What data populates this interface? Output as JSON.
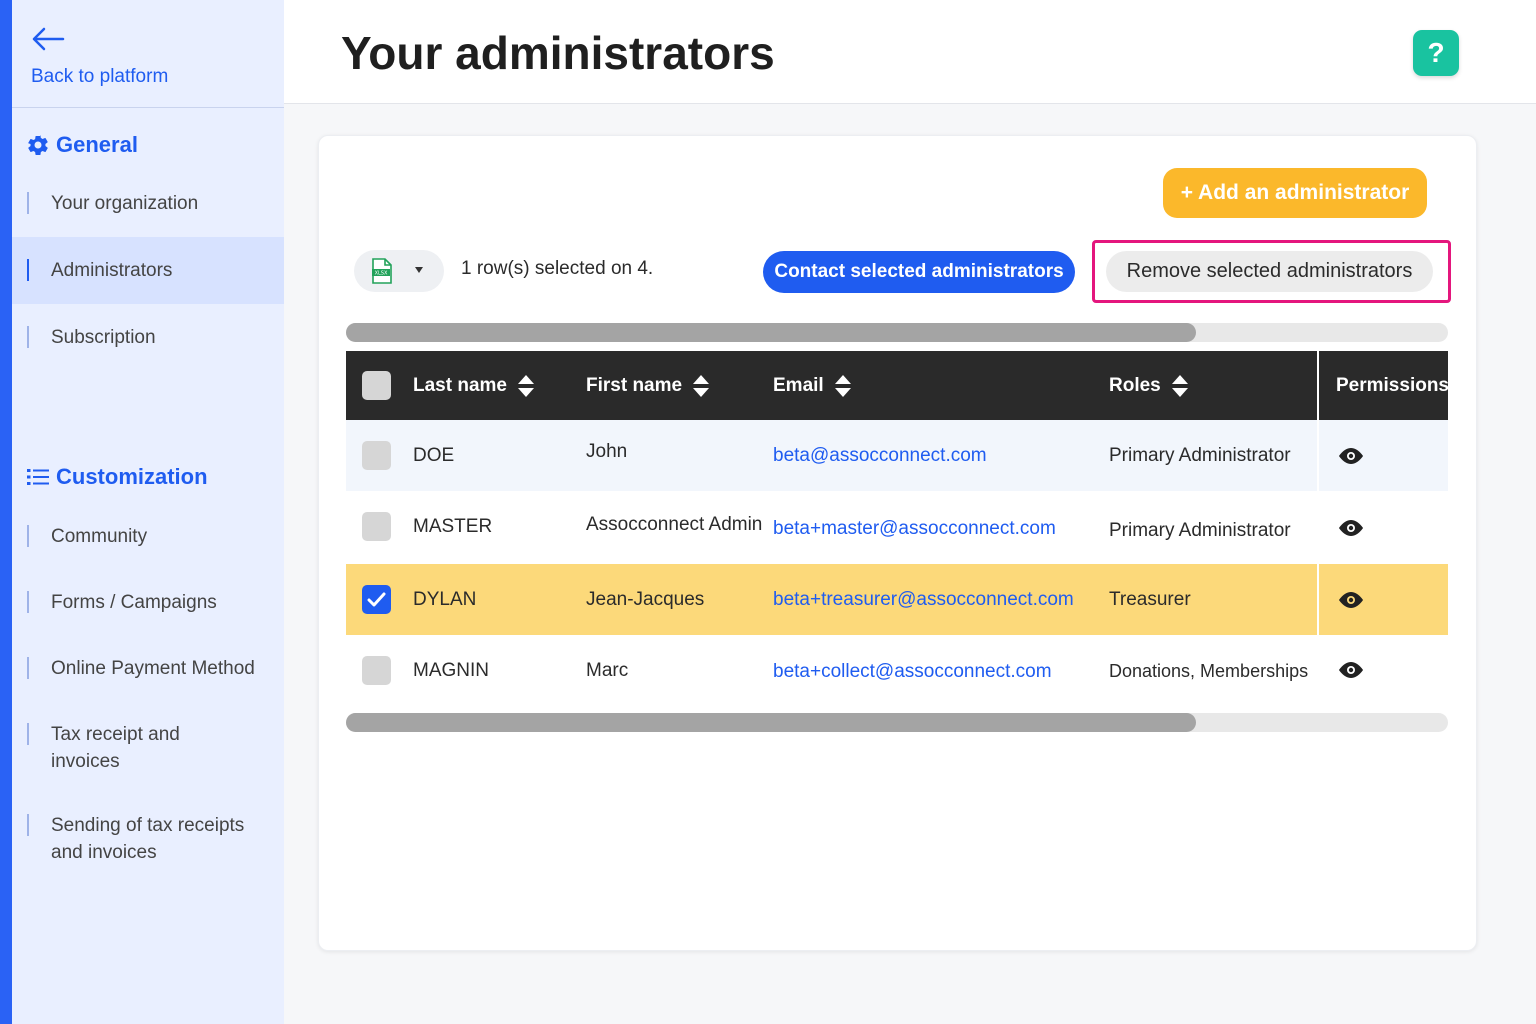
{
  "sidebar": {
    "back_label": "Back to platform",
    "sections": [
      {
        "title": "General",
        "items": [
          "Your organization",
          "Administrators",
          "Subscription"
        ]
      },
      {
        "title": "Customization",
        "items": [
          "Community",
          "Forms / Campaigns",
          "Online Payment Method",
          "Tax receipt and invoices",
          "Sending of tax receipts and invoices"
        ]
      }
    ],
    "active_item": "Administrators"
  },
  "header": {
    "title": "Your administrators",
    "help_label": "?"
  },
  "toolbar": {
    "add_label": "+ Add an administrator",
    "selection_text": "1 row(s) selected on 4.",
    "contact_label": "Contact selected administrators",
    "remove_label": "Remove selected administrators",
    "export_icon": "xlsx-file-icon",
    "export_badge": "XLSX"
  },
  "table": {
    "columns": [
      "Last name",
      "First name",
      "Email",
      "Roles",
      "Permissions"
    ],
    "rows": [
      {
        "last": "DOE",
        "first": "John",
        "email": "beta@assocconnect.com",
        "role": "Primary Administrator",
        "selected": false
      },
      {
        "last": "MASTER",
        "first": "Assocconnect Admin",
        "email": "beta+master@assocconnect.com",
        "role": "Primary Administrator",
        "selected": false
      },
      {
        "last": "DYLAN",
        "first": "Jean-Jacques",
        "email": "beta+treasurer@assocconnect.com",
        "role": "Treasurer",
        "selected": true
      },
      {
        "last": "MAGNIN",
        "first": "Marc",
        "email": "beta+collect@assocconnect.com",
        "role": "Donations, Memberships",
        "selected": false
      }
    ],
    "horizontal_scroll_fraction": 0.77
  },
  "colors": {
    "accent": "#1f5cf0",
    "add_button": "#fbb82b",
    "help_button": "#19c3a0",
    "selected_row": "#fcd97a",
    "highlight_frame": "#e4167d"
  }
}
